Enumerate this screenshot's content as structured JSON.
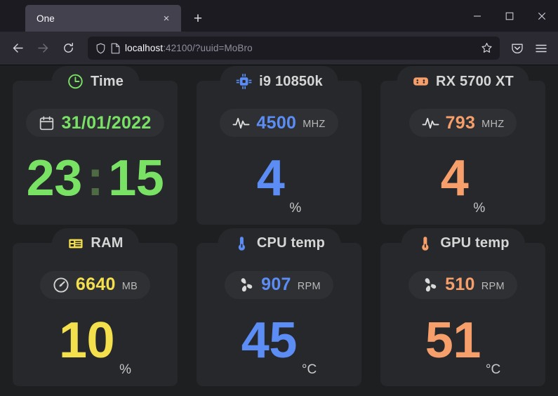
{
  "browser": {
    "tab": {
      "title": "One",
      "close_label": "×"
    },
    "newtab_label": "+",
    "window_controls": {
      "minimize": "minimize-button",
      "maximize": "maximize-button",
      "close": "close-button"
    },
    "nav": {
      "back": "back-button",
      "forward": "forward-button",
      "reload": "reload-button"
    },
    "url": {
      "host": "localhost",
      "rest": ":42100/?uuid=MoBro",
      "full": "localhost:42100/?uuid=MoBro"
    },
    "toolbar": {
      "bookmark": "bookmark-star-icon",
      "pocket": "pocket-icon",
      "menu": "hamburger-menu-icon"
    }
  },
  "colors": {
    "page_bg": "#1e1f21",
    "card_bg": "#26282b",
    "pill_bg": "#2e3033",
    "green": "#79e265",
    "green_dim": "#4e6b44",
    "blue": "#5b8df5",
    "orange": "#f79f6b",
    "yellow": "#f4e04d",
    "title_text": "#d6d6d6",
    "unit_text": "#c9c9c9"
  },
  "cards": [
    {
      "id": "time",
      "title": "Time",
      "title_icon": "clock-icon",
      "accent": "#79e265",
      "sub": {
        "icon": "calendar-icon",
        "value": "31/01/2022",
        "unit": ""
      },
      "main": {
        "value": "23:15",
        "hours": "23",
        "separator": ":",
        "minutes": "15",
        "unit": ""
      }
    },
    {
      "id": "cpu",
      "title": "i9 10850k",
      "title_icon": "cpu-chip-icon",
      "accent": "#5b8df5",
      "sub": {
        "icon": "activity-pulse-icon",
        "value": "4500",
        "unit": "MHZ"
      },
      "main": {
        "value": "4",
        "unit": "%"
      }
    },
    {
      "id": "gpu",
      "title": "RX 5700 XT",
      "title_icon": "gamepad-icon",
      "accent": "#f79f6b",
      "sub": {
        "icon": "activity-pulse-icon",
        "value": "793",
        "unit": "MHZ"
      },
      "main": {
        "value": "4",
        "unit": "%"
      }
    },
    {
      "id": "ram",
      "title": "RAM",
      "title_icon": "memory-stick-icon",
      "accent": "#f4e04d",
      "sub": {
        "icon": "gauge-icon",
        "value": "6640",
        "unit": "MB"
      },
      "main": {
        "value": "10",
        "unit": "%"
      }
    },
    {
      "id": "cpu-temp",
      "title": "CPU temp",
      "title_icon": "thermometer-icon",
      "accent": "#5b8df5",
      "sub": {
        "icon": "fan-icon",
        "value": "907",
        "unit": "RPM"
      },
      "main": {
        "value": "45",
        "unit": "°C"
      }
    },
    {
      "id": "gpu-temp",
      "title": "GPU temp",
      "title_icon": "thermometer-icon",
      "accent": "#f79f6b",
      "sub": {
        "icon": "fan-icon",
        "value": "510",
        "unit": "RPM"
      },
      "main": {
        "value": "51",
        "unit": "°C"
      }
    }
  ]
}
